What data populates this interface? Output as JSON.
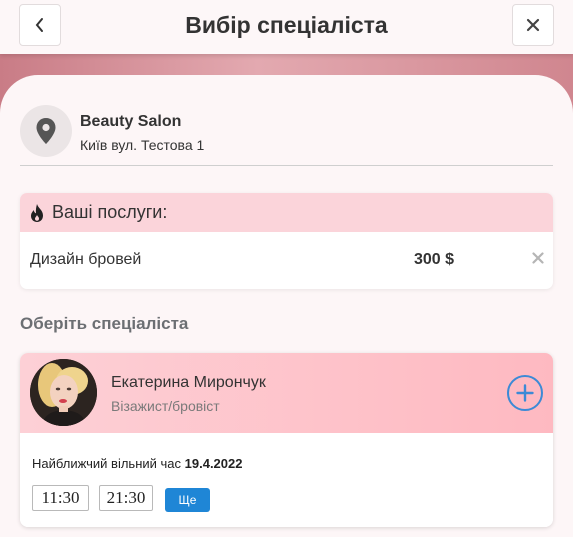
{
  "header": {
    "title": "Вибір спеціаліста",
    "back_icon": "chevron-left-icon",
    "close_icon": "close-icon"
  },
  "salon": {
    "name": "Beauty Salon",
    "address": "Київ вул. Тестова 1",
    "icon": "location-pin-icon"
  },
  "services": {
    "title": "Ваші послуги:",
    "icon": "fire-icon",
    "items": [
      {
        "name": "Дизайн бровей",
        "price": "300 $",
        "remove_icon": "close-icon"
      }
    ]
  },
  "specialists_section": {
    "title": "Оберіть спеціаліста",
    "items": [
      {
        "name": "Екатерина Мирончук",
        "role": "Візажист/бровіст",
        "nearest_label": "Найближчий вільний час",
        "nearest_date": "19.4.2022",
        "slots": [
          "11:30",
          "21:30"
        ],
        "more_label": "Ще",
        "add_icon": "plus-circle-icon"
      }
    ]
  },
  "colors": {
    "accent_blue": "#1f86d6",
    "service_header_bg": "#fbd4da",
    "specialist_header_bg": "#feb9c1",
    "band": "#d0868f"
  }
}
